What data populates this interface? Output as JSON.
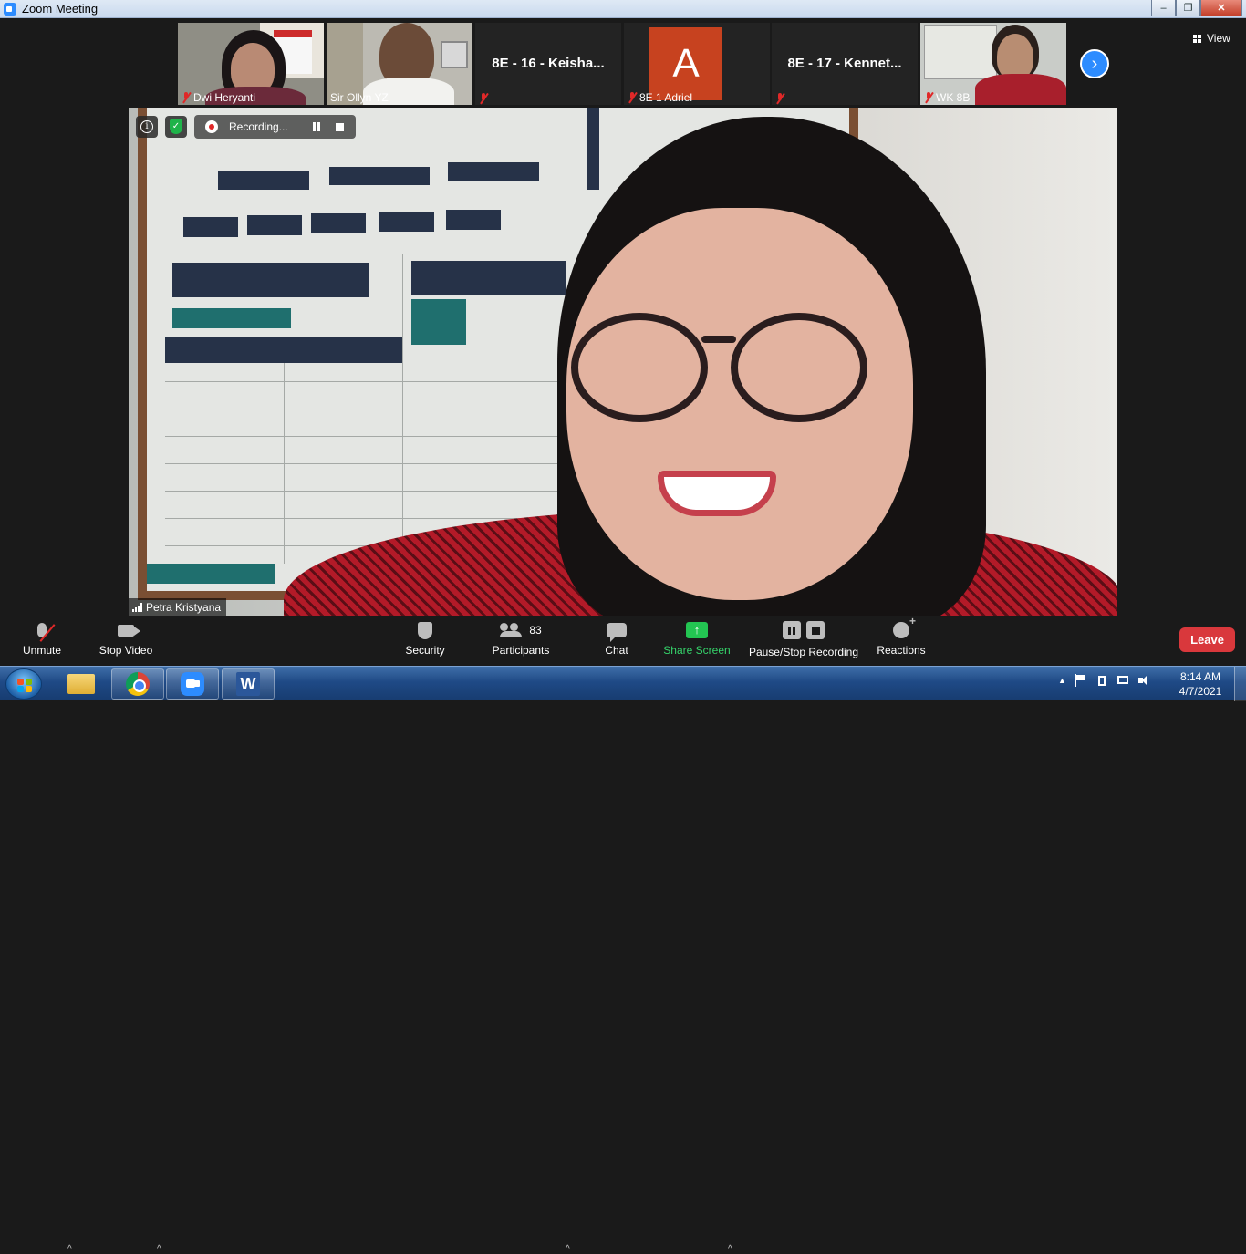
{
  "window": {
    "title": "Zoom Meeting",
    "min": "–",
    "max": "❐",
    "close": "✕"
  },
  "gallery": {
    "participants": [
      {
        "name": "Dwi Heryanti",
        "type": "video"
      },
      {
        "name": "Sir Ollyn YZ",
        "type": "video"
      },
      {
        "name": "",
        "display": "8E - 16 - Keisha...",
        "type": "name"
      },
      {
        "name": "8E 1 Adriel",
        "type": "avatar",
        "initial": "A",
        "color": "#c7421f"
      },
      {
        "name": "",
        "display": "8E - 17 - Kennet...",
        "type": "name"
      },
      {
        "name": "WK 8B",
        "type": "video"
      }
    ],
    "next_icon": "chevron-right-icon",
    "next_glyph": "›",
    "view_label": "View"
  },
  "main": {
    "speaker": "Petra Kristyana",
    "recording_status": "Recording...",
    "info_glyph": "i",
    "shield_glyph": "✓"
  },
  "toolbar": {
    "unmute": "Unmute",
    "stop_video": "Stop Video",
    "security": "Security",
    "participants": "Participants",
    "participant_count": "83",
    "chat": "Chat",
    "share_screen": "Share Screen",
    "share_glyph": "↑",
    "pause_stop_recording": "Pause/Stop Recording",
    "reactions": "Reactions",
    "leave": "Leave",
    "caret": "^"
  },
  "taskbar": {
    "apps": [
      "file-explorer",
      "chrome",
      "zoom",
      "word"
    ],
    "word_glyph": "W",
    "time": "8:14 AM",
    "date": "4/7/2021",
    "tray_up": "▲"
  },
  "colors": {
    "accent": "#2d8cff",
    "leave": "#d9383c",
    "share": "#23c552",
    "muted": "#e02828"
  }
}
